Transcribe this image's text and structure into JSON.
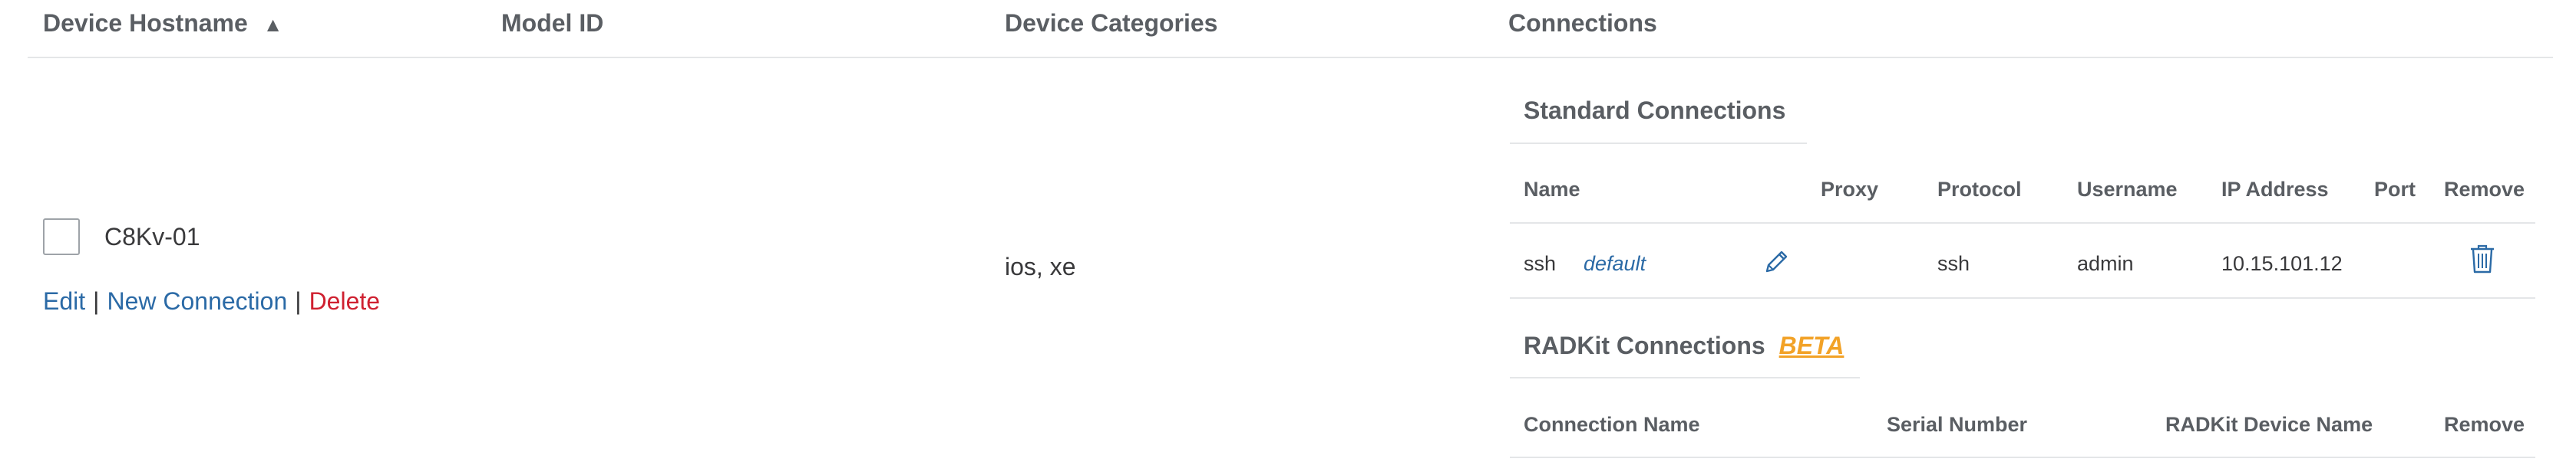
{
  "table": {
    "columns": {
      "hostname": "Device Hostname",
      "hostname_sort": "▲",
      "model_id": "Model ID",
      "categories": "Device Categories",
      "connections": "Connections"
    }
  },
  "row": {
    "hostname": "C8Kv-01",
    "actions": {
      "edit": "Edit",
      "new_connection": "New Connection",
      "delete": "Delete",
      "separator": "|"
    },
    "categories": "ios, xe"
  },
  "standard_connections": {
    "title": "Standard Connections",
    "headers": {
      "name": "Name",
      "proxy": "Proxy",
      "protocol": "Protocol",
      "username": "Username",
      "ip_address": "IP Address",
      "port": "Port",
      "remove": "Remove"
    },
    "rows": [
      {
        "name": "ssh",
        "default_label": "default",
        "edit_icon": "pencil-icon",
        "proxy": "",
        "protocol": "ssh",
        "username": "admin",
        "ip_address": "10.15.101.12",
        "port": "",
        "remove_icon": "trash-icon"
      }
    ]
  },
  "radkit_connections": {
    "title": "RADKit Connections",
    "beta_label": "BETA",
    "headers": {
      "connection_name": "Connection Name",
      "serial_number": "Serial Number",
      "device_name": "RADKit Device Name",
      "remove": "Remove"
    }
  },
  "colors": {
    "link": "#2b6aa6",
    "danger": "#cf2030",
    "beta": "#f2a227",
    "header_text": "#5a5e63",
    "divider": "#e4e6e8"
  }
}
